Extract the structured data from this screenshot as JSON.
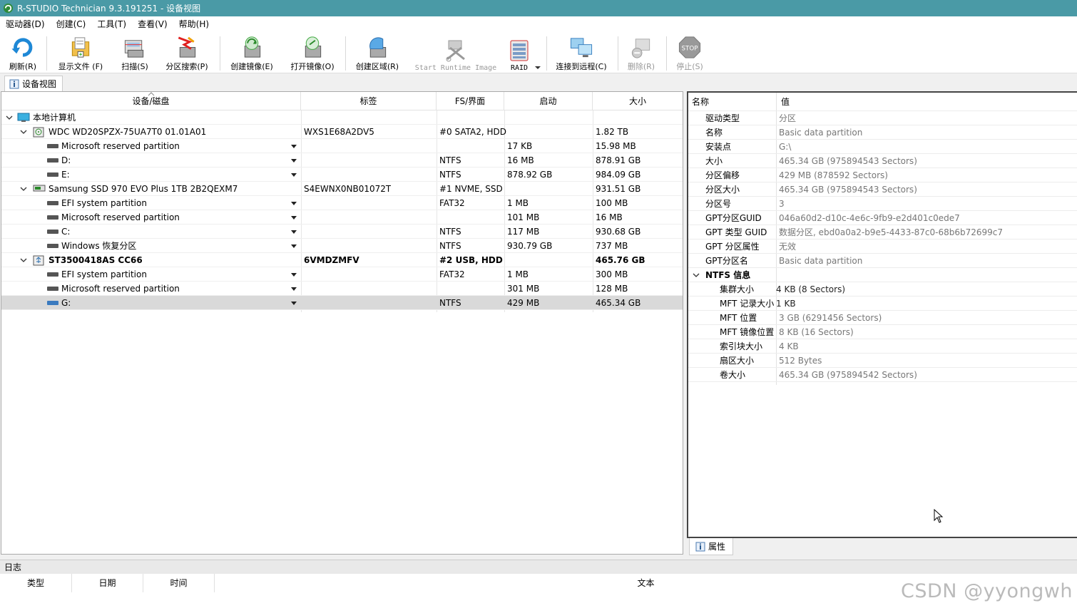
{
  "window": {
    "title": "R-STUDIO Technician 9.3.191251 - 设备视图"
  },
  "menu": [
    "驱动器(D)",
    "创建(C)",
    "工具(T)",
    "查看(V)",
    "帮助(H)"
  ],
  "toolbar": {
    "refresh": "刷新(R)",
    "show_files": "显示文件 (F)",
    "scan": "扫描(S)",
    "partition_search": "分区搜索(P)",
    "create_image": "创建镜像(E)",
    "open_image": "打开镜像(O)",
    "create_region": "创建区域(R)",
    "start_runtime_image": "Start Runtime Image",
    "raid": "RAID",
    "connect_remote": "连接到远程(C)",
    "delete": "删除(R)",
    "stop": "停止(S)",
    "stop_icon_text": "STOP"
  },
  "tabs": {
    "device_view": "设备视图",
    "properties": "属性"
  },
  "device_table": {
    "headers": {
      "device": "设备/磁盘",
      "label": "标签",
      "fs": "FS/界面",
      "start": "启动",
      "size": "大小"
    },
    "rows": [
      {
        "name": "本地计算机",
        "label": "",
        "fs": "",
        "start": "",
        "size": ""
      },
      {
        "name": "WDC WD20SPZX-75UA7T0 01.01A01",
        "label": "WXS1E68A2DV5",
        "fs": "#0 SATA2, HDD",
        "start": "",
        "size": "1.82 TB"
      },
      {
        "name": "Microsoft reserved partition",
        "label": "",
        "fs": "",
        "start": "17 KB",
        "size": "15.98 MB"
      },
      {
        "name": "D:",
        "label": "",
        "fs": "NTFS",
        "start": "16 MB",
        "size": "878.91 GB"
      },
      {
        "name": "E:",
        "label": "",
        "fs": "NTFS",
        "start": "878.92 GB",
        "size": "984.09 GB"
      },
      {
        "name": "Samsung SSD 970 EVO Plus 1TB 2B2QEXM7",
        "label": "S4EWNX0NB01072T",
        "fs": "#1 NVME, SSD",
        "start": "",
        "size": "931.51 GB"
      },
      {
        "name": "EFI system partition",
        "label": "",
        "fs": "FAT32",
        "start": "1 MB",
        "size": "100 MB"
      },
      {
        "name": "Microsoft reserved partition",
        "label": "",
        "fs": "",
        "start": "101 MB",
        "size": "16 MB"
      },
      {
        "name": "C:",
        "label": "",
        "fs": "NTFS",
        "start": "117 MB",
        "size": "930.68 GB"
      },
      {
        "name": "Windows 恢复分区",
        "label": "",
        "fs": "NTFS",
        "start": "930.79 GB",
        "size": "737 MB"
      },
      {
        "name": "ST3500418AS CC66",
        "label": "6VMDZMFV",
        "fs": "#2 USB, HDD",
        "start": "",
        "size": "465.76 GB"
      },
      {
        "name": "EFI system partition",
        "label": "",
        "fs": "FAT32",
        "start": "1 MB",
        "size": "300 MB"
      },
      {
        "name": "Microsoft reserved partition",
        "label": "",
        "fs": "",
        "start": "301 MB",
        "size": "128 MB"
      },
      {
        "name": "G:",
        "label": "",
        "fs": "NTFS",
        "start": "429 MB",
        "size": "465.34 GB"
      }
    ]
  },
  "properties": {
    "headers": {
      "name": "名称",
      "value": "值"
    },
    "rows": [
      {
        "name": "驱动类型",
        "value": "分区"
      },
      {
        "name": "名称",
        "value": "Basic data partition"
      },
      {
        "name": "安装点",
        "value": "G:\\"
      },
      {
        "name": "大小",
        "value": "465.34 GB (975894543 Sectors)"
      },
      {
        "name": "分区偏移",
        "value": "429 MB (878592 Sectors)"
      },
      {
        "name": "分区大小",
        "value": "465.34 GB (975894543 Sectors)"
      },
      {
        "name": "分区号",
        "value": "3"
      },
      {
        "name": "GPT分区GUID",
        "value": "046a60d2-d10c-4e6c-9fb9-e2d401c0ede7"
      },
      {
        "name": "GPT 类型 GUID",
        "value": "数据分区, ebd0a0a2-b9e5-4433-87c0-68b6b72699c7"
      },
      {
        "name": "GPT 分区属性",
        "value": "无效"
      },
      {
        "name": "GPT分区名",
        "value": "Basic data partition"
      },
      {
        "name": "NTFS 信息",
        "value": ""
      },
      {
        "name": "集群大小",
        "value": "4 KB (8 Sectors)"
      },
      {
        "name": "MFT 记录大小",
        "value": "1 KB"
      },
      {
        "name": "MFT 位置",
        "value": "3 GB (6291456 Sectors)"
      },
      {
        "name": "MFT 镜像位置",
        "value": "8 KB (16 Sectors)"
      },
      {
        "name": "索引块大小",
        "value": "4 KB"
      },
      {
        "name": "扇区大小",
        "value": "512 Bytes"
      },
      {
        "name": "卷大小",
        "value": "465.34 GB (975894542 Sectors)"
      }
    ]
  },
  "log": {
    "title": "日志",
    "headers": {
      "type": "类型",
      "date": "日期",
      "time": "时间",
      "text": "文本"
    }
  },
  "watermark": "CSDN @yyongwh"
}
